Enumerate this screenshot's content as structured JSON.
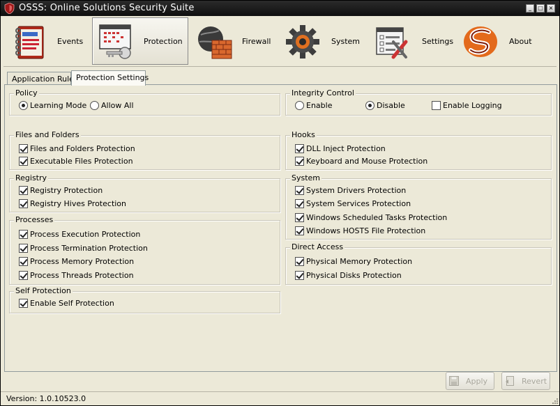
{
  "window": {
    "title": "OSSS: Online Solutions Security Suite"
  },
  "toolbar": {
    "items": [
      {
        "label": "Events",
        "icon": "notebook-icon"
      },
      {
        "label": "Protection",
        "icon": "window-key-icon"
      },
      {
        "label": "Firewall",
        "icon": "globe-wall-icon"
      },
      {
        "label": "System",
        "icon": "gear-icon"
      },
      {
        "label": "Settings",
        "icon": "settings-tools-icon"
      },
      {
        "label": "About",
        "icon": "logo-s-icon"
      }
    ],
    "active": "Protection"
  },
  "tabs": [
    {
      "label": "Application Rules"
    },
    {
      "label": "Protection Settings"
    }
  ],
  "policy": {
    "title": "Policy",
    "learning_mode": "Learning Mode",
    "allow_all": "Allow All",
    "selected": "Learning Mode"
  },
  "integrity": {
    "title": "Integrity Control",
    "enable": "Enable",
    "disable": "Disable",
    "enable_logging": "Enable Logging",
    "selected": "Disable",
    "logging_checked": false
  },
  "files_folders": {
    "title": "Files and Folders",
    "items": [
      "Files and Folders Protection",
      "Executable Files Protection"
    ]
  },
  "registry": {
    "title": "Registry",
    "items": [
      "Registry Protection",
      "Registry Hives Protection"
    ]
  },
  "processes": {
    "title": "Processes",
    "items": [
      "Process Execution Protection",
      "Process Termination Protection",
      "Process Memory Protection",
      "Process Threads Protection"
    ]
  },
  "self_protection": {
    "title": "Self Protection",
    "items": [
      "Enable Self Protection"
    ]
  },
  "hooks": {
    "title": "Hooks",
    "items": [
      "DLL Inject Protection",
      "Keyboard and Mouse Protection"
    ]
  },
  "system": {
    "title": "System",
    "items": [
      "System Drivers Protection",
      "System Services Protection",
      "Windows Scheduled Tasks Protection",
      "Windows HOSTS File Protection"
    ]
  },
  "direct_access": {
    "title": "Direct Access",
    "items": [
      "Physical Memory Protection",
      "Physical Disks Protection"
    ]
  },
  "buttons": {
    "apply": "Apply",
    "revert": "Revert"
  },
  "status": {
    "version": "Version: 1.0.10523.0"
  },
  "colors": {
    "titlebar": "#151515",
    "background": "#ece9d8",
    "border": "#919b9c"
  }
}
